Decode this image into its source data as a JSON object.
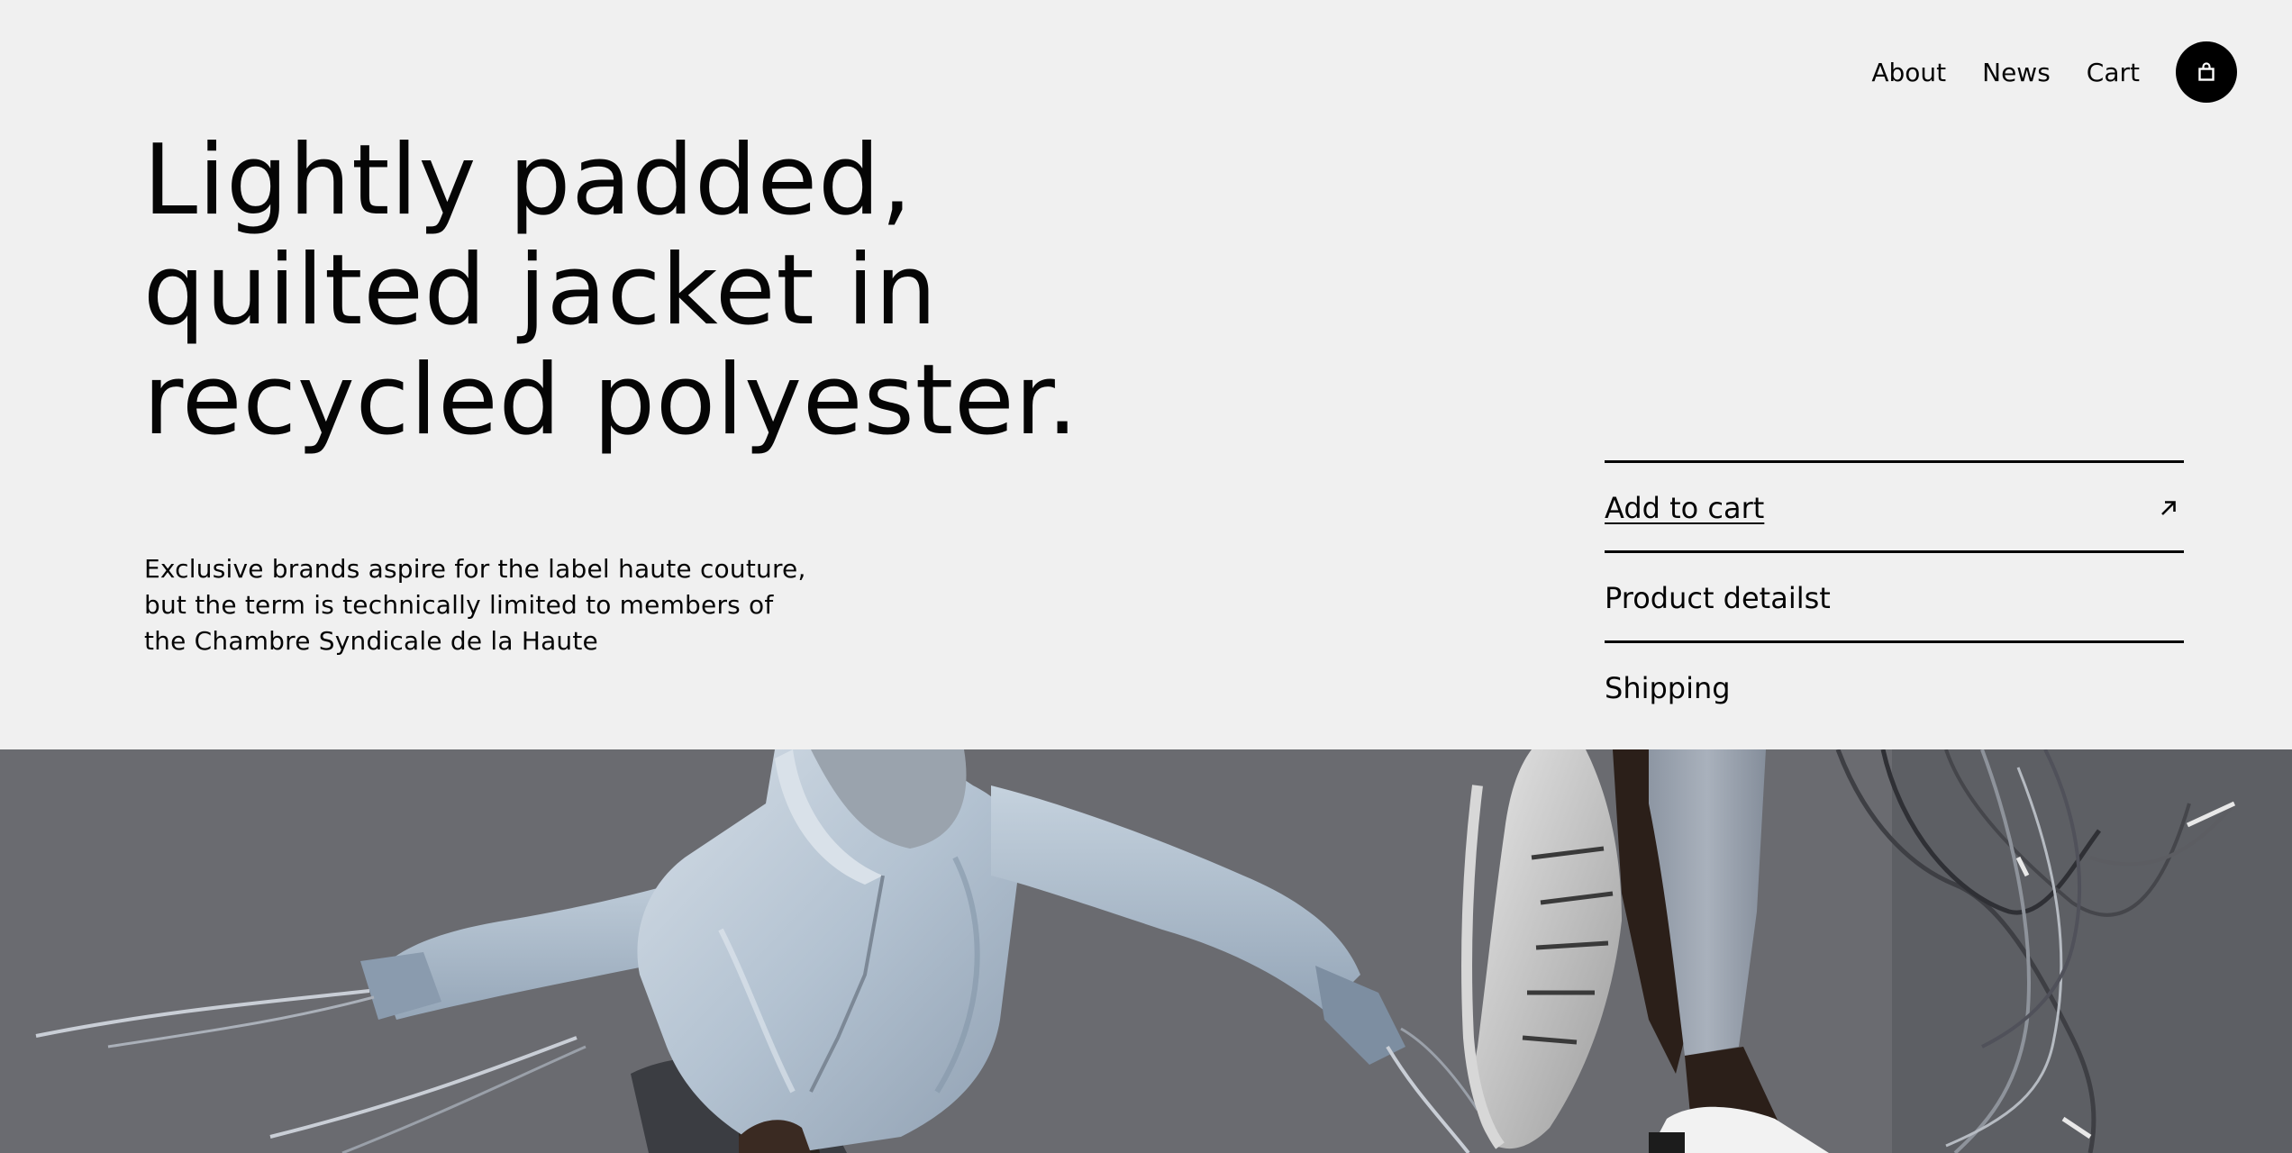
{
  "nav": {
    "links": [
      "About",
      "News",
      "Cart"
    ],
    "cart_icon": "shopping-bag-icon"
  },
  "hero_text": {
    "headline_lines": [
      "Lightly padded,",
      "quilted jacket in",
      "recycled polyester."
    ],
    "description_lines": [
      "Exclusive brands aspire for the label haute couture,",
      "but the term is technically limited to members of",
      "the Chambre Syndicale de la Haute"
    ]
  },
  "actions": {
    "items": [
      {
        "label": "Add to cart",
        "icon": "arrow-up-right-icon"
      },
      {
        "label": "Product detailst"
      },
      {
        "label": "Shipping"
      }
    ]
  },
  "colors": {
    "background": "#f0f0f0",
    "text": "#050505",
    "button": "#000000",
    "photo_backdrop": "#66676c",
    "jacket": "#b7c5d3"
  }
}
